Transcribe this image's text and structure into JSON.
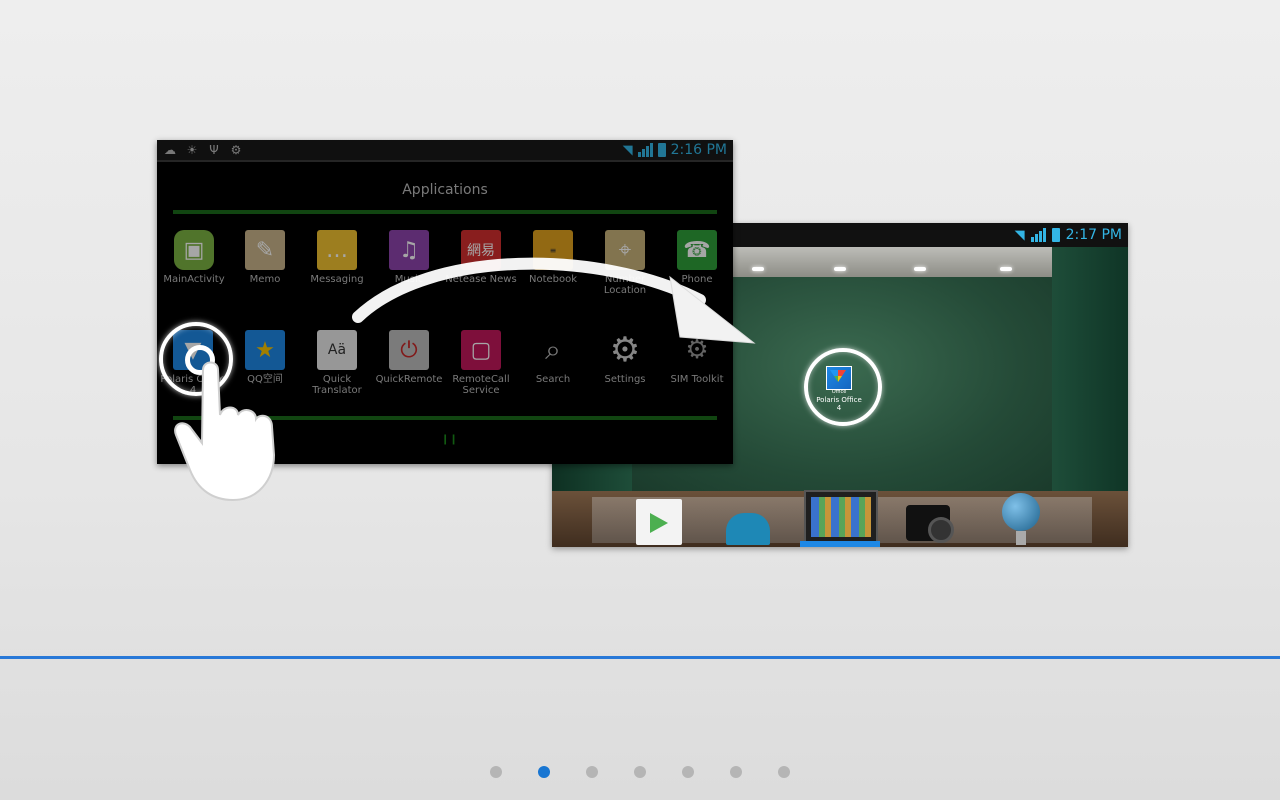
{
  "screen1": {
    "time": "2:16 PM",
    "title": "Applications",
    "notification_icons": [
      "weather-icon",
      "weather-icon",
      "usb-icon",
      "android-debug-icon"
    ],
    "apps_row1": [
      {
        "label": "MainActivity",
        "icon": "android-icon",
        "color": "#7cb342"
      },
      {
        "label": "Memo",
        "icon": "memo-icon",
        "color": "#c9b48a"
      },
      {
        "label": "Messaging",
        "icon": "messaging-icon",
        "color": "#f2c230"
      },
      {
        "label": "Music",
        "icon": "music-icon",
        "color": "#8e44ad"
      },
      {
        "label": "Netease News",
        "icon": "netease-icon",
        "color": "#d32f2f"
      },
      {
        "label": "Notebook",
        "icon": "notebook-icon",
        "color": "#e0a21e"
      },
      {
        "label": "Number Location",
        "icon": "number-location-icon",
        "color": "#c8b27a"
      },
      {
        "label": "Phone",
        "icon": "phone-icon",
        "color": "#2e9e3a"
      }
    ],
    "apps_row2": [
      {
        "label": "Polaris Office 4",
        "icon": "polaris-office-icon",
        "color": "#1e88e5"
      },
      {
        "label": "QQ空间",
        "icon": "qzone-icon",
        "color": "#1e88e5"
      },
      {
        "label": "Quick Translator",
        "icon": "translator-icon",
        "color": "#e8e8e8"
      },
      {
        "label": "QuickRemote",
        "icon": "remote-icon",
        "color": "#bdbdbd"
      },
      {
        "label": "RemoteCall Service",
        "icon": "remotecall-icon",
        "color": "#c2185b"
      },
      {
        "label": "Search",
        "icon": "search-icon",
        "color": "#000000"
      },
      {
        "label": "Settings",
        "icon": "settings-icon",
        "color": "#000000"
      },
      {
        "label": "SIM Toolkit",
        "icon": "sim-toolkit-icon",
        "color": "#9e9e9e"
      }
    ]
  },
  "screen2": {
    "time": "2:17 PM",
    "placed_app_office": "Office",
    "placed_app_label": "Polaris Office 4"
  },
  "pagination": {
    "total": 7,
    "active_index": 1
  },
  "colors": {
    "accent": "#1976d2",
    "status_blue": "#33b5e5",
    "drawer_green": "#1b6b1b"
  }
}
